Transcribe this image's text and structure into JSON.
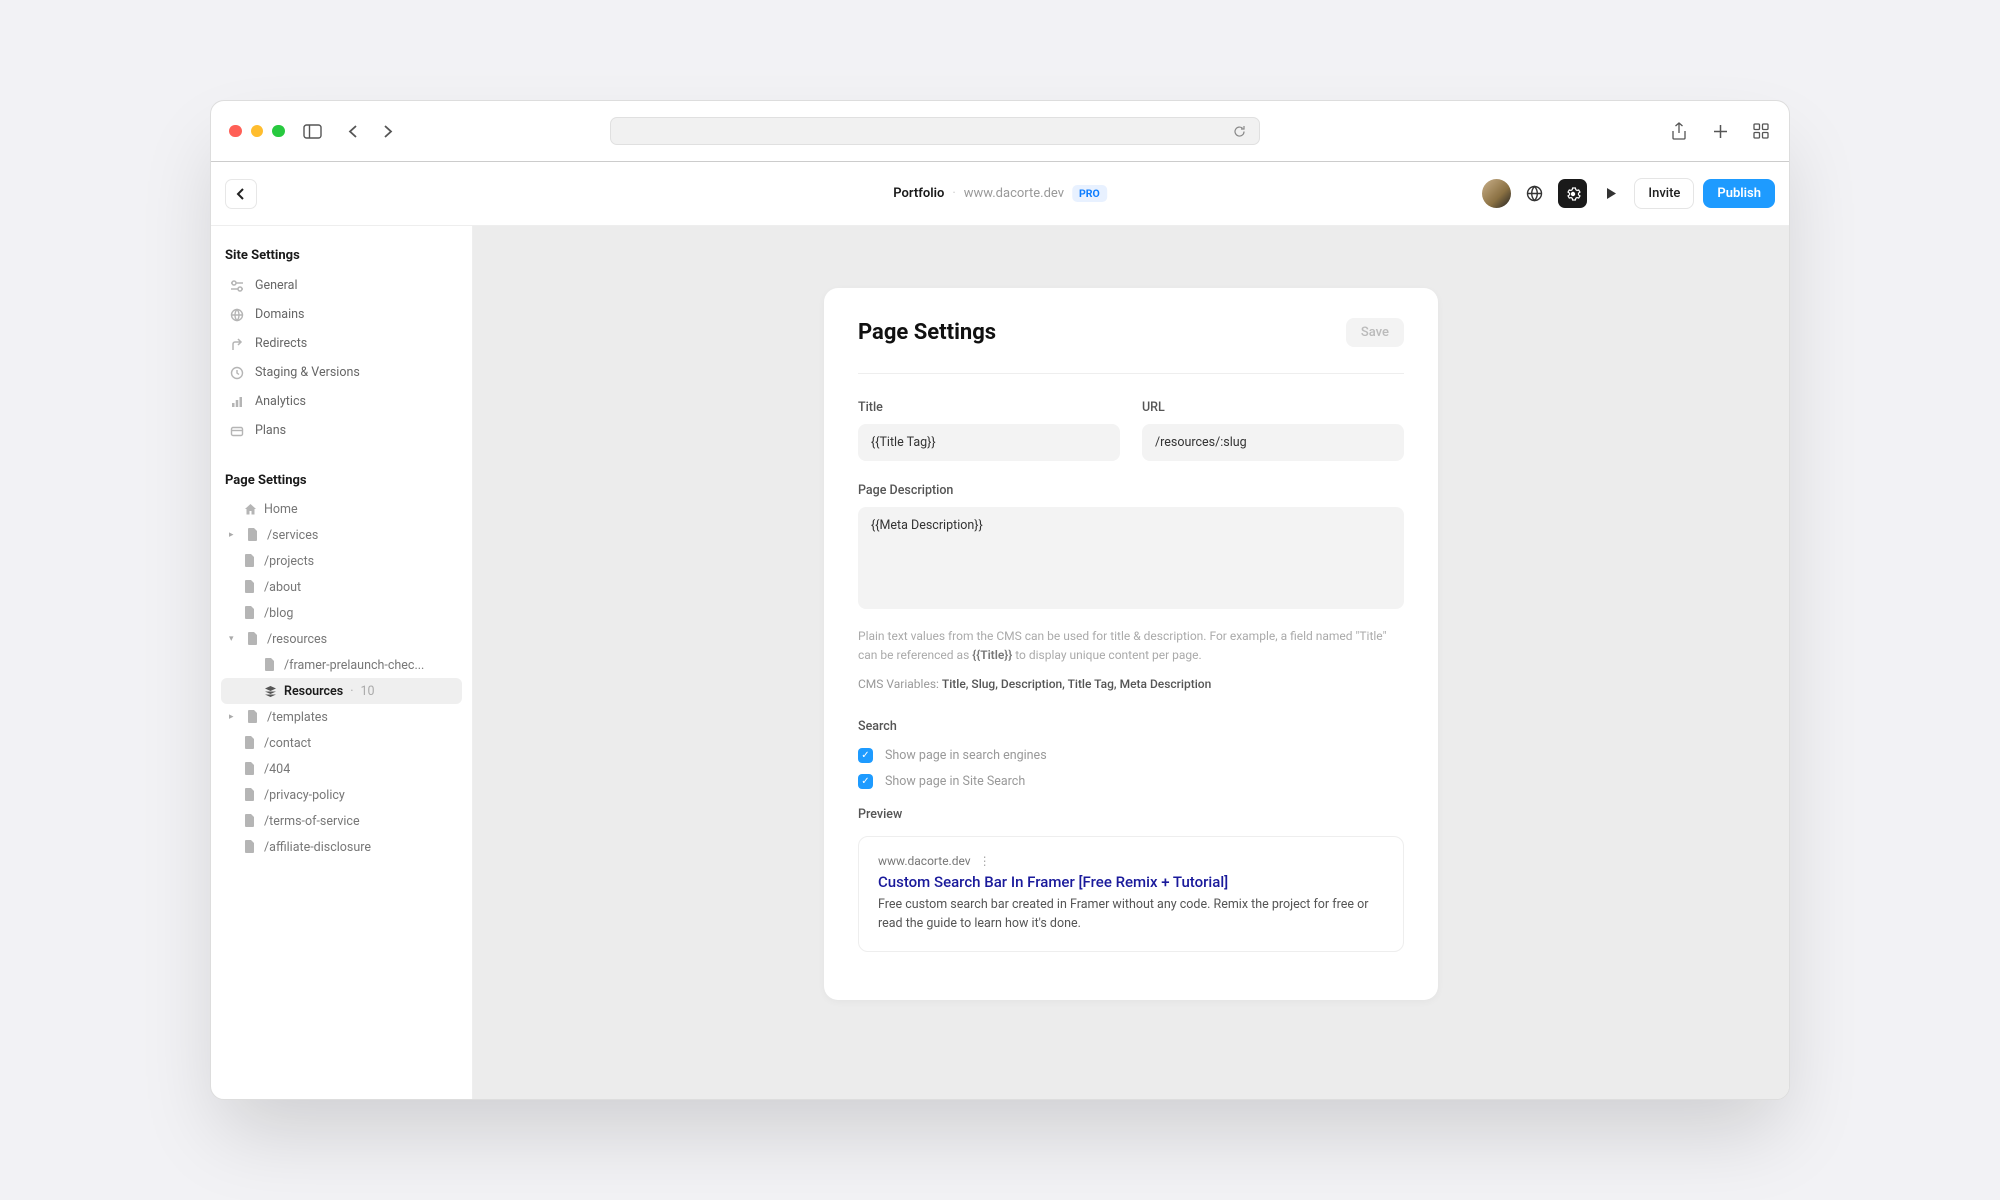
{
  "appbar": {
    "project": "Portfolio",
    "domain": "www.dacorte.dev",
    "badge": "PRO",
    "invite": "Invite",
    "publish": "Publish"
  },
  "sidebar": {
    "site_settings": {
      "header": "Site Settings",
      "items": [
        "General",
        "Domains",
        "Redirects",
        "Staging & Versions",
        "Analytics",
        "Plans"
      ]
    },
    "page_settings": {
      "header": "Page Settings",
      "home": "Home",
      "pages": [
        "/services",
        "/projects",
        "/about",
        "/blog",
        "/resources",
        "/framer-prelaunch-chec...",
        "Resources",
        "/templates",
        "/contact",
        "/404",
        "/privacy-policy",
        "/terms-of-service",
        "/affiliate-disclosure"
      ],
      "resources_count": "10"
    }
  },
  "panel": {
    "title": "Page Settings",
    "save": "Save",
    "title_label": "Title",
    "title_value": "{{Title Tag}}",
    "url_label": "URL",
    "url_value": "/resources/:slug",
    "desc_label": "Page Description",
    "desc_value": "{{Meta Description}}",
    "help_pre": "Plain text values from the CMS can be used for title & description. For example, a field named \"Title\" can be referenced as ",
    "help_bold": "{{Title}}",
    "help_post": " to display unique content per page.",
    "cms_label": "CMS Variables: ",
    "cms_vars": "Title, Slug, Description, Title Tag, Meta Description",
    "search_label": "Search",
    "check1": "Show page in search engines",
    "check2": "Show page in Site Search",
    "preview_label": "Preview",
    "pv_domain": "www.dacorte.dev",
    "pv_title": "Custom Search Bar In Framer [Free Remix + Tutorial]",
    "pv_desc": "Free custom search bar created in Framer without any code. Remix the project for free or read the guide to learn how it's done."
  }
}
